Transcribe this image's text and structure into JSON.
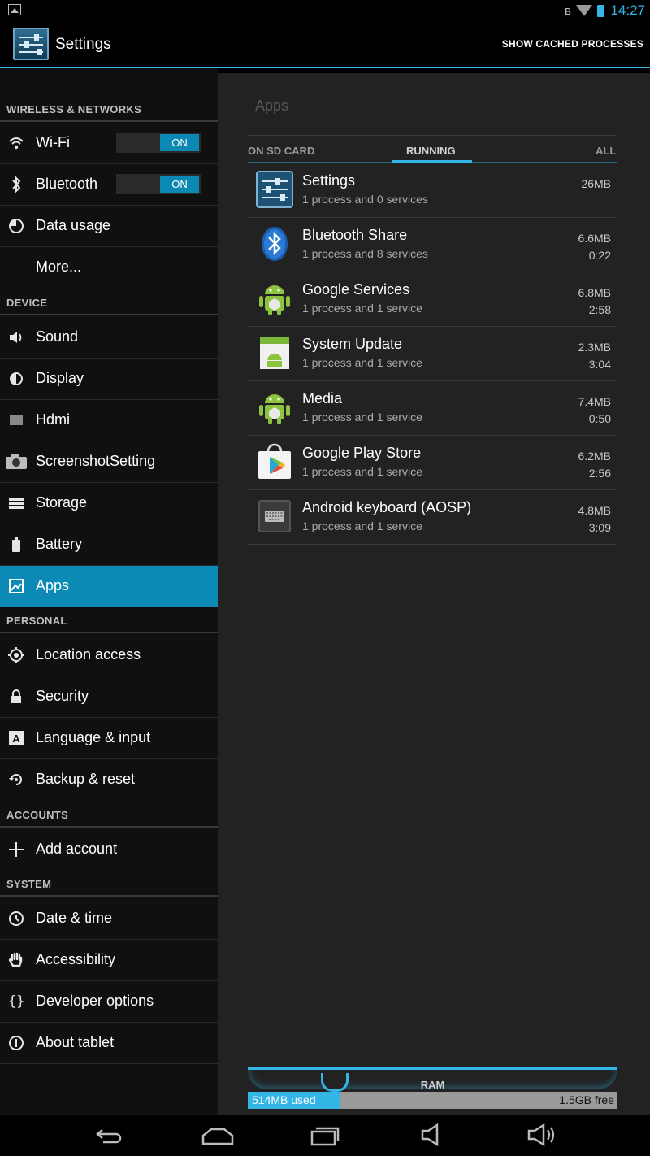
{
  "status_bar": {
    "time": "14:27",
    "icons": [
      "gallery-notification-icon",
      "bluetooth-icon",
      "wifi-icon",
      "battery-icon"
    ]
  },
  "action_bar": {
    "title": "Settings",
    "menu_action": "SHOW CACHED PROCESSES"
  },
  "sidebar": {
    "sections": [
      {
        "header": "WIRELESS & NETWORKS"
      },
      {
        "header": "DEVICE"
      },
      {
        "header": "PERSONAL"
      },
      {
        "header": "ACCOUNTS"
      },
      {
        "header": "SYSTEM"
      }
    ],
    "items": [
      {
        "label": "Wi-Fi",
        "toggle": "ON",
        "icon": "wifi-icon"
      },
      {
        "label": "Bluetooth",
        "toggle": "ON",
        "icon": "bluetooth-icon"
      },
      {
        "label": "Data usage",
        "icon": "data-usage-icon"
      },
      {
        "label": "More...",
        "icon": ""
      },
      {
        "label": "Sound",
        "icon": "speaker-icon"
      },
      {
        "label": "Display",
        "icon": "brightness-icon"
      },
      {
        "label": "Hdmi",
        "icon": "hdmi-icon"
      },
      {
        "label": "ScreenshotSetting",
        "icon": "camera-icon"
      },
      {
        "label": "Storage",
        "icon": "storage-icon"
      },
      {
        "label": "Battery",
        "icon": "battery-icon"
      },
      {
        "label": "Apps",
        "icon": "apps-icon",
        "selected": true
      },
      {
        "label": "Location access",
        "icon": "location-icon"
      },
      {
        "label": "Security",
        "icon": "lock-icon"
      },
      {
        "label": "Language & input",
        "icon": "language-icon"
      },
      {
        "label": "Backup & reset",
        "icon": "backup-icon"
      },
      {
        "label": "Add account",
        "icon": "plus-icon"
      },
      {
        "label": "Date & time",
        "icon": "clock-icon"
      },
      {
        "label": "Accessibility",
        "icon": "hand-icon"
      },
      {
        "label": "Developer options",
        "icon": "braces-icon"
      },
      {
        "label": "About tablet",
        "icon": "info-icon"
      }
    ]
  },
  "content": {
    "section_title": "Apps",
    "tabs": [
      {
        "label": "ON SD CARD"
      },
      {
        "label": "RUNNING",
        "active": true
      },
      {
        "label": "ALL"
      }
    ],
    "apps": [
      {
        "name": "Settings",
        "detail": "1 process and 0 services",
        "size": "26MB",
        "time": "",
        "icon": "settings-app-icon"
      },
      {
        "name": "Bluetooth Share",
        "detail": "1 process and 8 services",
        "size": "6.6MB",
        "time": "0:22",
        "icon": "bluetooth-share-icon"
      },
      {
        "name": "Google Services",
        "detail": "1 process and 1 service",
        "size": "6.8MB",
        "time": "2:58",
        "icon": "android-icon"
      },
      {
        "name": "System Update",
        "detail": "1 process and 1 service",
        "size": "2.3MB",
        "time": "3:04",
        "icon": "system-update-icon"
      },
      {
        "name": "Media",
        "detail": "1 process and 1 service",
        "size": "7.4MB",
        "time": "0:50",
        "icon": "android-icon"
      },
      {
        "name": "Google Play Store",
        "detail": "1 process and 1 service",
        "size": "6.2MB",
        "time": "2:56",
        "icon": "play-store-icon"
      },
      {
        "name": "Android keyboard (AOSP)",
        "detail": "1 process and 1 service",
        "size": "4.8MB",
        "time": "3:09",
        "icon": "keyboard-icon"
      }
    ],
    "ram": {
      "label": "RAM",
      "used": "514MB used",
      "free": "1.5GB free",
      "used_fraction": 0.25
    }
  },
  "nav_bar": {
    "buttons": [
      "back-icon",
      "home-icon",
      "recents-icon",
      "volume-down-icon",
      "volume-up-icon"
    ]
  },
  "colors": {
    "accent": "#33b5e5",
    "selected": "#0b8ab6",
    "sidebar_bg": "#101010",
    "content_bg": "#222222"
  }
}
